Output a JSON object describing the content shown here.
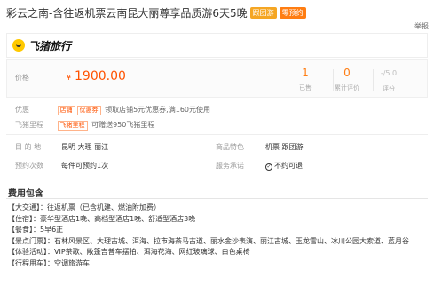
{
  "title": {
    "text": "彩云之南-含往返机票云南昆大丽尊享品质游6天5晚",
    "tag1": "跟团游",
    "tag2": "零预约"
  },
  "report_label": "举报",
  "brand": {
    "logo_text": "飞猪旅行"
  },
  "price": {
    "label": "价格",
    "currency": "¥",
    "value": "1900.00",
    "stats": [
      {
        "num": "1",
        "label": "已售"
      },
      {
        "num": "0",
        "label": "累计评价"
      },
      {
        "num": "-/5.0",
        "label": "评分"
      }
    ]
  },
  "promo": {
    "label": "优惠",
    "badge1": "店铺",
    "badge2": "优惠券",
    "text": "领取店铺5元优惠券,满160元使用"
  },
  "mileage": {
    "label": "飞猪里程",
    "badge": "飞猪里程",
    "text": "可赠送950飞猪里程"
  },
  "info": {
    "dest_label": "目 的 地",
    "dest_value": "昆明  大理  丽江",
    "feature_label": "商品特色",
    "feature_value": "机票  跟团游",
    "times_label": "预约次数",
    "times_value": "每件可预约1次",
    "service_label": "服务承诺",
    "service_value": "不约可退"
  },
  "fees": {
    "title": "费用包含",
    "items": [
      "【大交通】：往返机票（已含机建、燃油附加费）",
      "【住宿】：豪华型酒店1晚、高档型酒店1晚、舒适型酒店3晚",
      "【餐食】：5早6正",
      "【景点门票】：石林风景区、大理古城、洱海、拉市海茶马古道、丽水金沙表演、丽江古城、玉龙雪山、冰川公园大索道、蓝月谷",
      "【体验活动】：VIP茶歌、敞篷吉普车摆拍、洱海花海、网红玻璃球、白色桌椅",
      "【行程用车】：空调旅游车"
    ]
  },
  "colors": {
    "accent": "#ff5200",
    "brand": "#ffc900"
  }
}
